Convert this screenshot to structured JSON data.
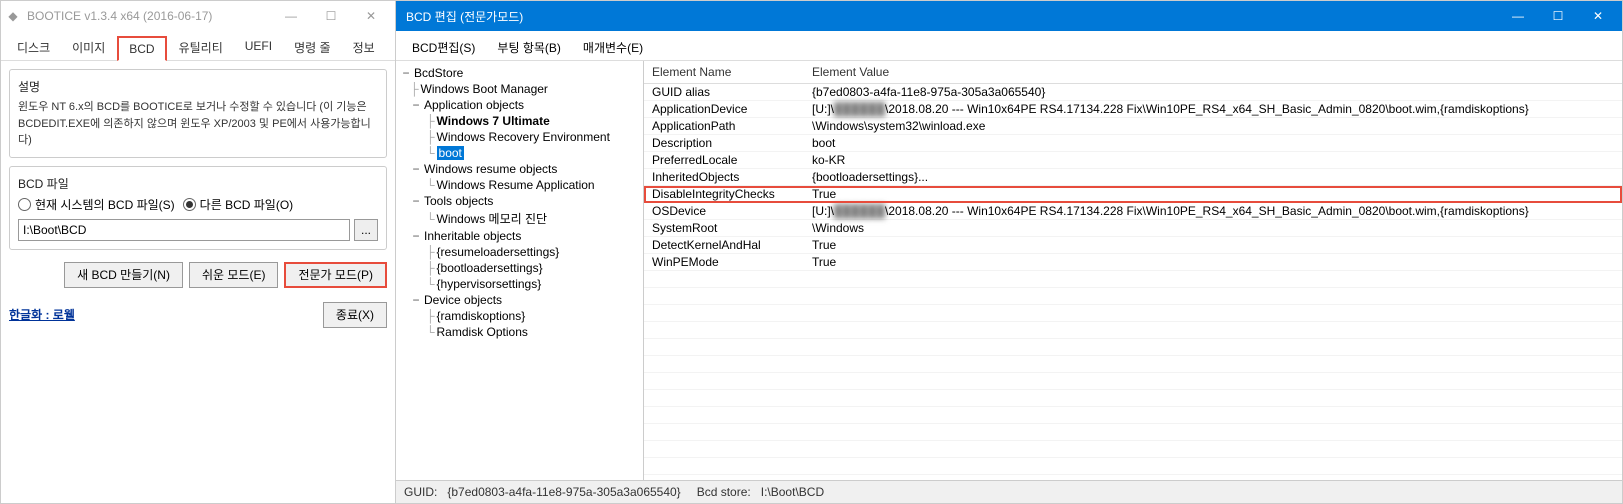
{
  "left": {
    "title": "BOOTICE v1.3.4 x64 (2016-06-17)",
    "tabs": [
      "디스크",
      "이미지",
      "BCD",
      "유틸리티",
      "UEFI",
      "명령 줄",
      "정보"
    ],
    "active_tab": 2,
    "desc_legend": "설명",
    "desc_text": "윈도우 NT 6.x의 BCD를 BOOTICE로 보거나 수정할 수 있습니다\n(이 기능은 BCDEDIT.EXE에 의존하지 않으며 윈도우 XP/2003 및 PE에서 사용가능합니다)",
    "bcd_legend": "BCD 파일",
    "radio_current": "현재 시스템의 BCD 파일(S)",
    "radio_other": "다른 BCD 파일(O)",
    "bcd_path": "I:\\Boot\\BCD",
    "browse": "...",
    "btn_new": "새 BCD 만들기(N)",
    "btn_easy": "쉬운 모드(E)",
    "btn_expert": "전문가 모드(P)",
    "footer_link": "한글화 : 로웰",
    "btn_exit": "종료(X)"
  },
  "right": {
    "title": "BCD 편집 (전문가모드)",
    "menus": [
      "BCD편집(S)",
      "부팅 항목(B)",
      "매개변수(E)"
    ],
    "tree": [
      {
        "label": "BcdStore",
        "indent": 0,
        "toggle": "−"
      },
      {
        "label": "Windows Boot Manager",
        "indent": 1,
        "guide": "├"
      },
      {
        "label": "Application objects",
        "indent": 1,
        "toggle": "−",
        "guide": "├"
      },
      {
        "label": "Windows 7 Ultimate",
        "indent": 2,
        "bold": true,
        "guide": "├"
      },
      {
        "label": "Windows Recovery Environment",
        "indent": 2,
        "guide": "├"
      },
      {
        "label": "boot",
        "indent": 2,
        "selected": true,
        "guide": "└"
      },
      {
        "label": "Windows resume objects",
        "indent": 1,
        "toggle": "−",
        "guide": "├"
      },
      {
        "label": "Windows Resume Application",
        "indent": 2,
        "guide": "└"
      },
      {
        "label": "Tools objects",
        "indent": 1,
        "toggle": "−",
        "guide": "├"
      },
      {
        "label": "Windows 메모리 진단",
        "indent": 2,
        "guide": "└"
      },
      {
        "label": "Inheritable objects",
        "indent": 1,
        "toggle": "−",
        "guide": "├"
      },
      {
        "label": "{resumeloadersettings}",
        "indent": 2,
        "guide": "├"
      },
      {
        "label": "{bootloadersettings}",
        "indent": 2,
        "guide": "├"
      },
      {
        "label": "{hypervisorsettings}",
        "indent": 2,
        "guide": "└"
      },
      {
        "label": "Device objects",
        "indent": 1,
        "toggle": "−",
        "guide": "└"
      },
      {
        "label": "{ramdiskoptions}",
        "indent": 2,
        "guide": "├"
      },
      {
        "label": "Ramdisk Options",
        "indent": 2,
        "guide": "└"
      }
    ],
    "header": {
      "name": "Element Name",
      "value": "Element Value"
    },
    "rows": [
      {
        "name": "GUID alias",
        "value": "{b7ed0803-a4fa-11e8-975a-305a3a065540}"
      },
      {
        "name": "ApplicationDevice",
        "value": "[U:]\\██████\\2018.08.20 --- Win10x64PE RS4.17134.228 Fix\\Win10PE_RS4_x64_SH_Basic_Admin_0820\\boot.wim,{ramdiskoptions}",
        "blur": true
      },
      {
        "name": "ApplicationPath",
        "value": "\\Windows\\system32\\winload.exe"
      },
      {
        "name": "Description",
        "value": "boot"
      },
      {
        "name": "PreferredLocale",
        "value": "ko-KR"
      },
      {
        "name": "InheritedObjects",
        "value": "{bootloadersettings}..."
      },
      {
        "name": "DisableIntegrityChecks",
        "value": "True",
        "highlight": true
      },
      {
        "name": "OSDevice",
        "value": "[U:]\\██████\\2018.08.20 --- Win10x64PE RS4.17134.228 Fix\\Win10PE_RS4_x64_SH_Basic_Admin_0820\\boot.wim,{ramdiskoptions}",
        "blur": true
      },
      {
        "name": "SystemRoot",
        "value": "\\Windows"
      },
      {
        "name": "DetectKernelAndHal",
        "value": "True"
      },
      {
        "name": "WinPEMode",
        "value": "True"
      }
    ],
    "status_guid_label": "GUID:",
    "status_guid": "{b7ed0803-a4fa-11e8-975a-305a3a065540}",
    "status_store_label": "Bcd store:",
    "status_store": "I:\\Boot\\BCD"
  }
}
